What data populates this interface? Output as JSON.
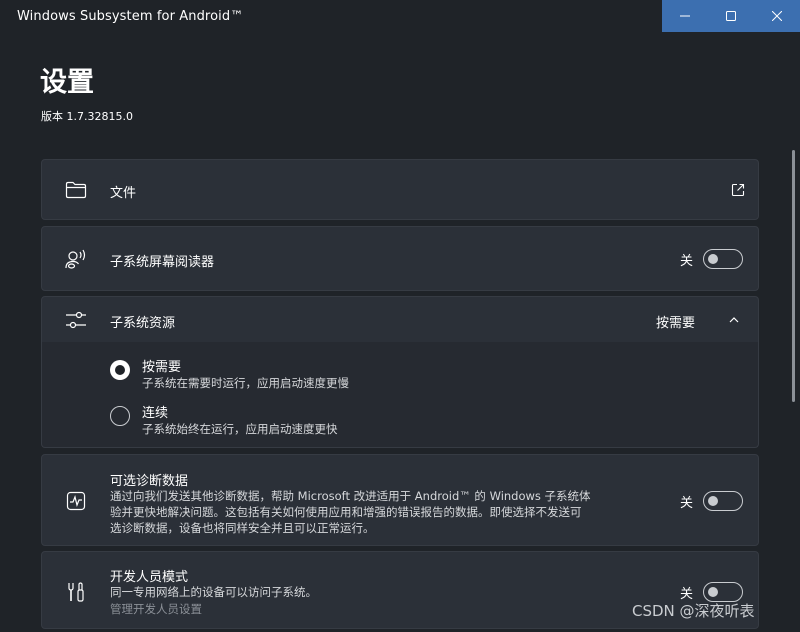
{
  "window": {
    "title": "Windows Subsystem for Android™"
  },
  "caption": {
    "minimize_icon": "minimize-icon",
    "maximize_icon": "maximize-icon",
    "close_icon": "close-icon"
  },
  "page": {
    "title": "设置",
    "version": "版本 1.7.32815.0"
  },
  "files": {
    "label": "文件",
    "icon": "folder-icon",
    "action_icon": "external-link-icon"
  },
  "screen_reader": {
    "label": "子系统屏幕阅读器",
    "icon": "narrator-icon",
    "state_text": "关",
    "on": false
  },
  "resources": {
    "label": "子系统资源",
    "icon": "sliders-icon",
    "value": "按需要",
    "expanded": true,
    "options": [
      {
        "label": "按需要",
        "desc": "子系统在需要时运行，应用启动速度更慢",
        "selected": true
      },
      {
        "label": "连续",
        "desc": "子系统始终在运行，应用启动速度更快",
        "selected": false
      }
    ]
  },
  "diagnostics": {
    "label": "可选诊断数据",
    "icon": "activity-icon",
    "desc_lines": [
      "通过向我们发送其他诊断数据，帮助 Microsoft 改进适用于 Android™ 的 Windows 子系统体",
      "验并更快地解决问题。这包括有关如何使用应用和增强的错误报告的数据。即使选择不发送可",
      "选诊断数据，设备也将同样安全并且可以正常运行。"
    ],
    "state_text": "关",
    "on": false
  },
  "developer": {
    "label": "开发人员模式",
    "icon": "tools-icon",
    "desc": "同一专用网络上的设备可以访问子系统。",
    "link": "管理开发人员设置",
    "state_text": "关",
    "on": false
  },
  "watermark": "CSDN @深夜听表"
}
